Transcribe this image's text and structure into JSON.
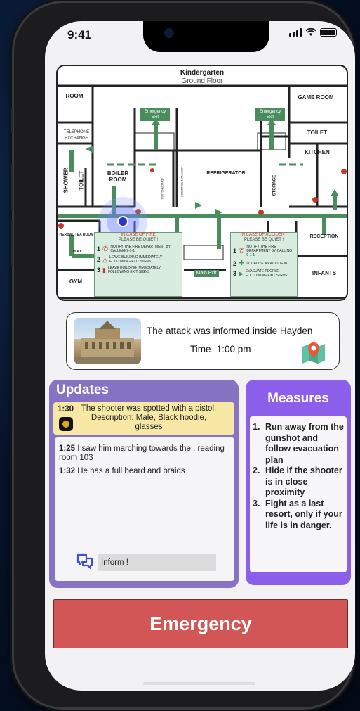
{
  "status_bar": {
    "time": "9:41"
  },
  "map": {
    "title": "Kindergarten",
    "subtitle": "Ground Floor",
    "rooms": {
      "room": "ROOM",
      "game_room": "GAME ROOM",
      "telephone": "TELEPHONE EXCHANGE",
      "toilet_right": "TOILET",
      "kitchen": "KITCHEN",
      "shower": "SHOWER",
      "toilet_left": "TOILET",
      "boiler": "BOILER ROOM",
      "refrigerator": "REFRIGERATOR",
      "storage": "STORAGE",
      "switchboard": "SWITCHBOARD",
      "logistics": "LOGISTICS MANAGER",
      "herbal": "HERBAL TEA ROOM",
      "pool": "POOL",
      "gym": "GYM",
      "reception": "RECEPTION",
      "infants": "INFANTS"
    },
    "exits": {
      "emergency_left": "Emergency Exit",
      "emergency_right": "Emergency Exit",
      "main": "Main Exit"
    },
    "fire_panel": {
      "head1": "IN CASE OF FIRE",
      "head2": "PLEASE BE QUIET !",
      "step1": "NOTIFY THE FIRE DEPARTMENT BY CALLING 9-1-1",
      "step2": "LEAVE BUILDING IMMEDIATELY FOLLOWING EXIT SIGNS",
      "step3": "LEAVE BUILDING IMMEDIATELY FOLLOWING EXIT SIGNS"
    },
    "accident_panel": {
      "head1": "IN CASE OF ACCIDENT",
      "head2": "PLEASE BE QUIET !",
      "step1": "NOTIFY THE FIRE DEPARTMENT BY CALLING 9-1-1",
      "step2": "LOCALIZE AN ACCIDENT",
      "step3": "EVACUATE PEOPLE FOLLOWING EXIT SIGNS"
    }
  },
  "info_card": {
    "message": "The attack was informed inside Hayden",
    "time": "Time- 1:00 pm"
  },
  "updates": {
    "title": "Updates",
    "alert": {
      "time": "1:30",
      "text": "The shooter was spotted with a pistol. Description: Male, Black hoodie, glasses"
    },
    "feed": [
      {
        "time": "1:25",
        "text": "I saw him marching towards the  . reading room  103"
      },
      {
        "time": "1:32",
        "text": "He has a full beard and braids"
      }
    ],
    "inform_value": "Inform !"
  },
  "measures": {
    "title": "Measures",
    "items": [
      {
        "n": "1.",
        "text": "Run away from the gunshot and follow evacuation plan"
      },
      {
        "n": "2.",
        "text": "Hide if the shooter is in close proximity"
      },
      {
        "n": "3.",
        "text": "Fight as a last resort, only if your life is in danger."
      }
    ]
  },
  "emergency_button": "Emergency",
  "colors": {
    "updates_bg": "#8673c4",
    "measures_bg": "#8b5fea",
    "emergency_bg": "#d35656",
    "alert_bg": "#f7e9a5",
    "map_green": "#4a8c5e",
    "location_dot": "#2a33d9"
  }
}
